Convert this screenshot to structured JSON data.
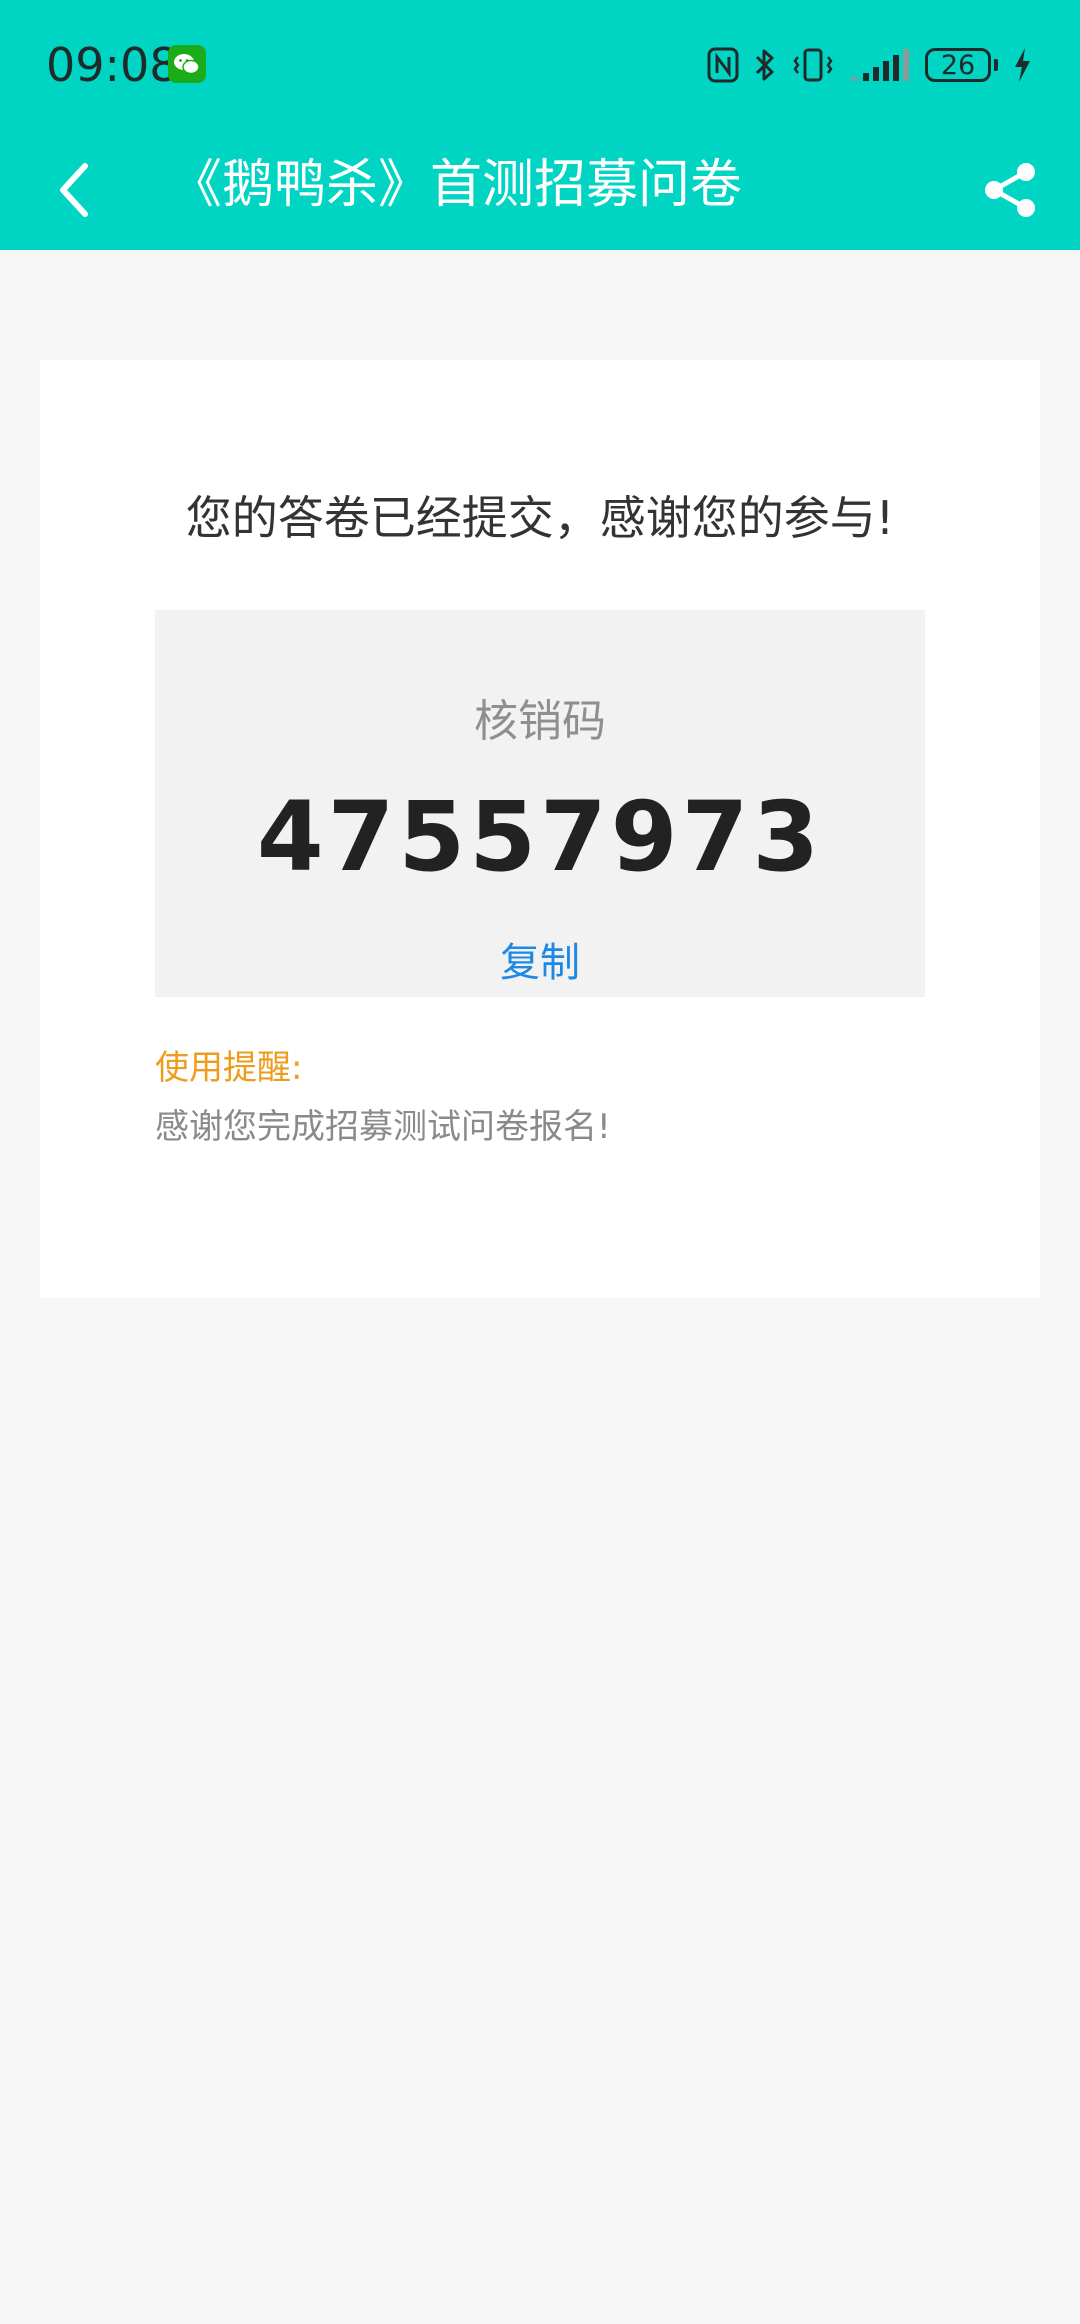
{
  "status_bar": {
    "time": "09:08",
    "battery_level": "26",
    "icons": [
      "wechat-icon",
      "nfc-icon",
      "bluetooth-icon",
      "vibrate-icon",
      "signal-icon",
      "battery-icon",
      "charging-icon"
    ]
  },
  "header": {
    "title": "《鹅鸭杀》首测招募问卷",
    "back_icon": "chevron-left-icon",
    "share_icon": "share-icon"
  },
  "result": {
    "message": "您的答卷已经提交，感谢您的参与!",
    "code_label": "核销码",
    "code_value": "47557973",
    "copy_label": "复制"
  },
  "reminder": {
    "title": "使用提醒:",
    "text": "感谢您完成招募测试问卷报名!"
  },
  "colors": {
    "header_bg": "#00d4c3",
    "page_bg": "#f6f6f6",
    "card_bg": "#ffffff",
    "code_box_bg": "#f2f2f2",
    "copy_link": "#1e88e5",
    "reminder_title": "#ef9b1b"
  }
}
